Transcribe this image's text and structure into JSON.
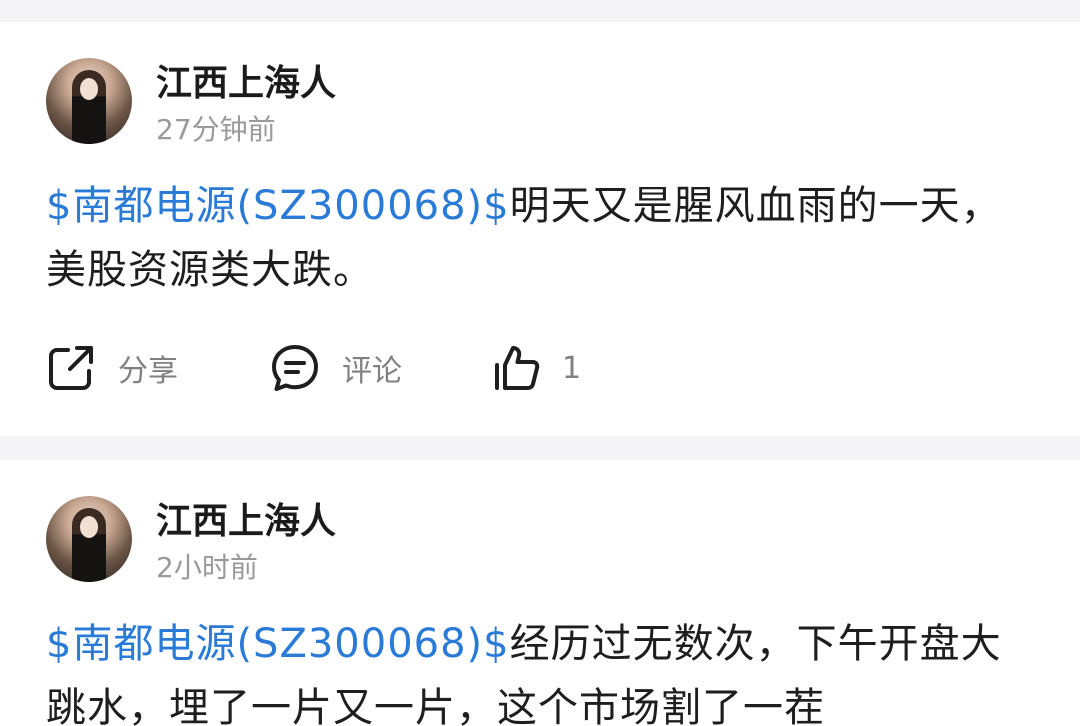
{
  "posts": [
    {
      "author": "江西上海人",
      "time": "27分钟前",
      "stock_tag": "$南都电源(SZ300068)$",
      "text": "明天又是腥风血雨的一天，美股资源类大跌。",
      "actions": {
        "share_label": "分享",
        "comment_label": "评论",
        "like_count": "1"
      }
    },
    {
      "author": "江西上海人",
      "time": "2小时前",
      "stock_tag": "$南都电源(SZ300068)$",
      "text": "经历过无数次，下午开盘大跳水，埋了一片又一片，这个市场割了一茬"
    }
  ],
  "colors": {
    "stock_link": "#2a7ad8",
    "author": "#1b1b1b",
    "muted": "#9a9a9a",
    "background": "#f4f4f6"
  },
  "icons": {
    "share": "share-icon",
    "comment": "comment-icon",
    "like": "thumbs-up-icon"
  }
}
